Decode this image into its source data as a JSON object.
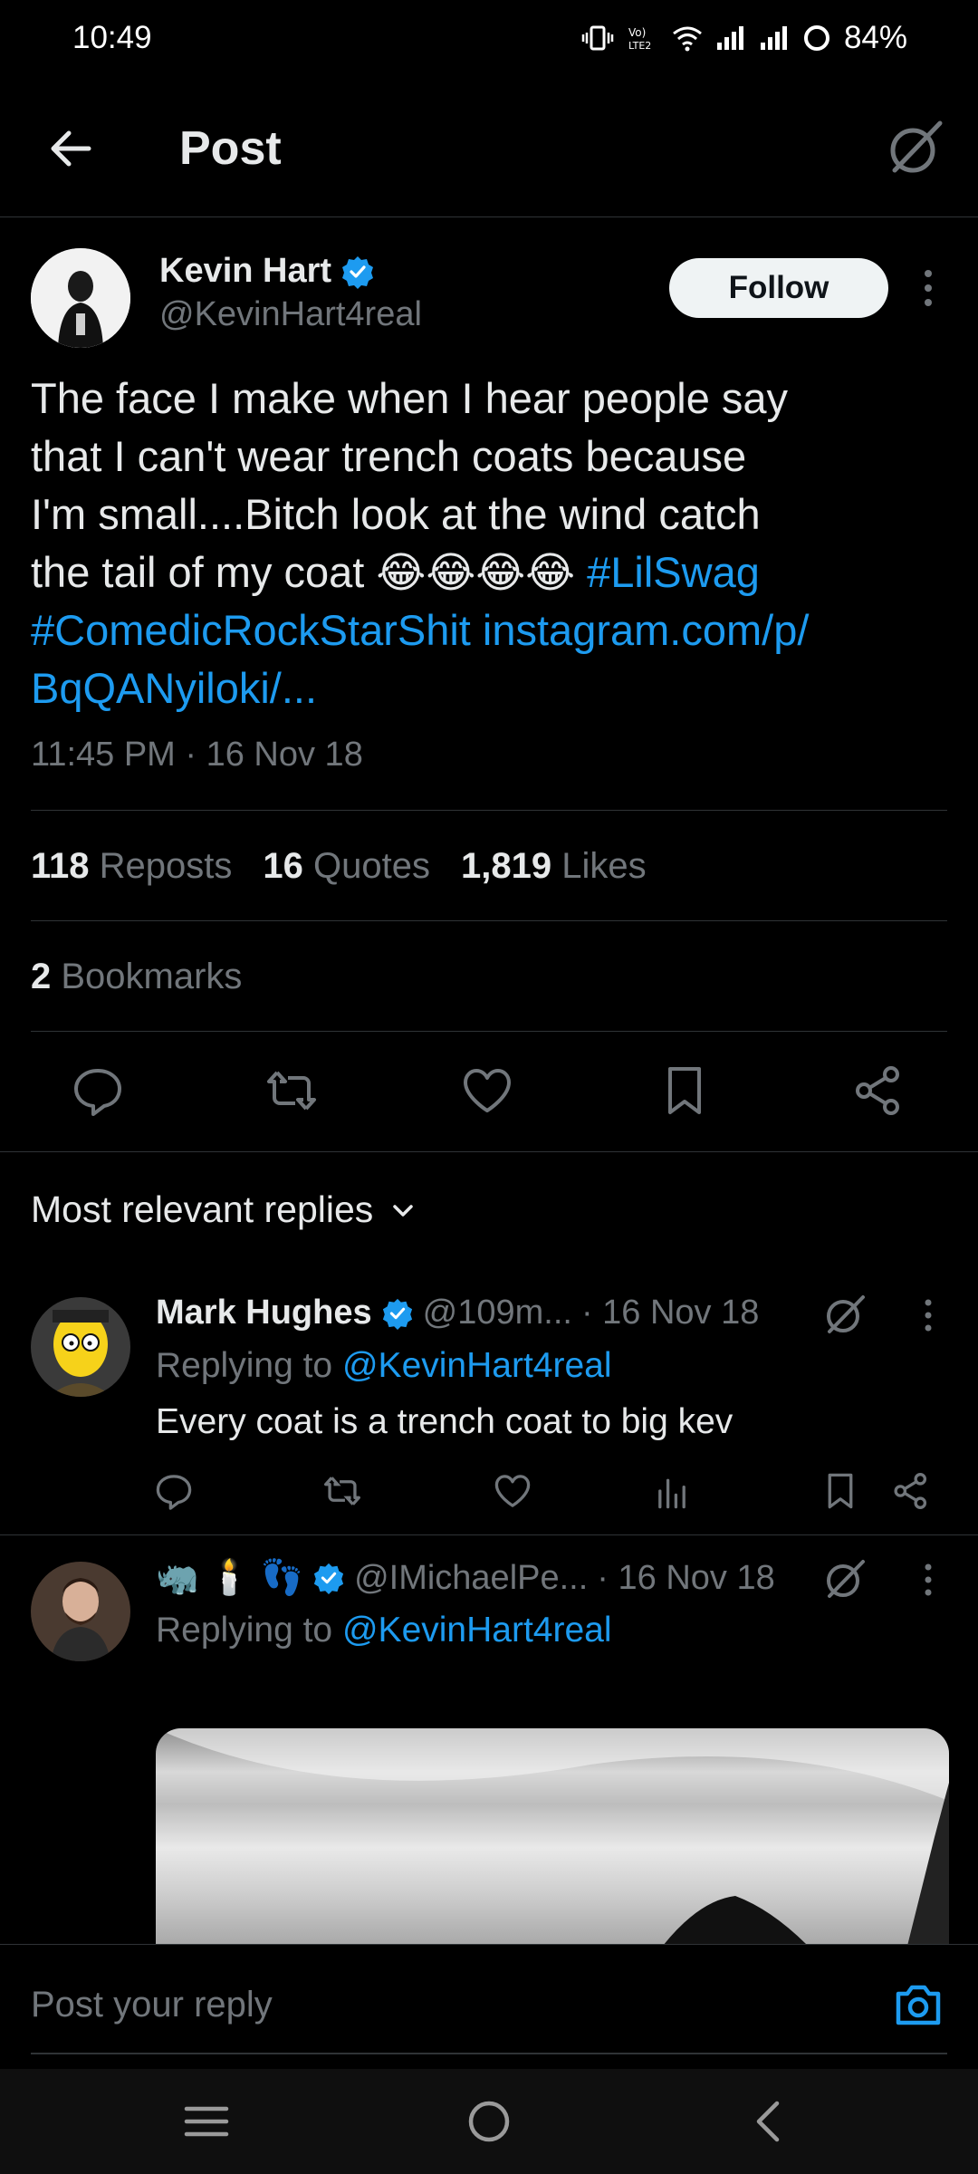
{
  "status": {
    "time": "10:49",
    "battery": "84%",
    "network": "LTE2"
  },
  "header": {
    "title": "Post"
  },
  "author": {
    "name": "Kevin Hart",
    "handle": "@KevinHart4real",
    "verified": true,
    "follow_label": "Follow"
  },
  "tweet": {
    "text_line1": "The face I make when I hear people say",
    "text_line2": "that I can't wear trench coats because",
    "text_line3": "I'm small....Bitch look at the wind catch",
    "text_line4_prefix": "the tail of my coat ",
    "emojis": "😂😂😂😂",
    "hashtag1": "#LilSwag",
    "hashtag2": "#ComedicRockStarShit",
    "link_part1": "instagram.com/p/",
    "link_part2": "BqQANyiloki/...",
    "timestamp": "11:45 PM · 16 Nov 18"
  },
  "stats": {
    "reposts_count": "118",
    "reposts_label": "Reposts",
    "quotes_count": "16",
    "quotes_label": "Quotes",
    "likes_count": "1,819",
    "likes_label": "Likes",
    "bookmarks_count": "2",
    "bookmarks_label": "Bookmarks"
  },
  "replies_sort": {
    "label": "Most relevant replies"
  },
  "replies": [
    {
      "name": "Mark Hughes",
      "handle": "@109m...",
      "date": "· 16 Nov 18",
      "replying_prefix": "Replying to",
      "replying_to": "@KevinHart4real",
      "body": "Every coat is a trench coat to big kev"
    },
    {
      "name_emojis": "🦏 🕯️ 👣",
      "handle": "@IMichaelPe...",
      "date": "· 16 Nov 18",
      "replying_prefix": "Replying to",
      "replying_to": "@KevinHart4real"
    }
  ],
  "composer": {
    "placeholder": "Post your reply"
  },
  "colors": {
    "background": "#000000",
    "accent": "#1d9bf0",
    "secondary_text": "#71767b",
    "divider": "#2f3336"
  }
}
